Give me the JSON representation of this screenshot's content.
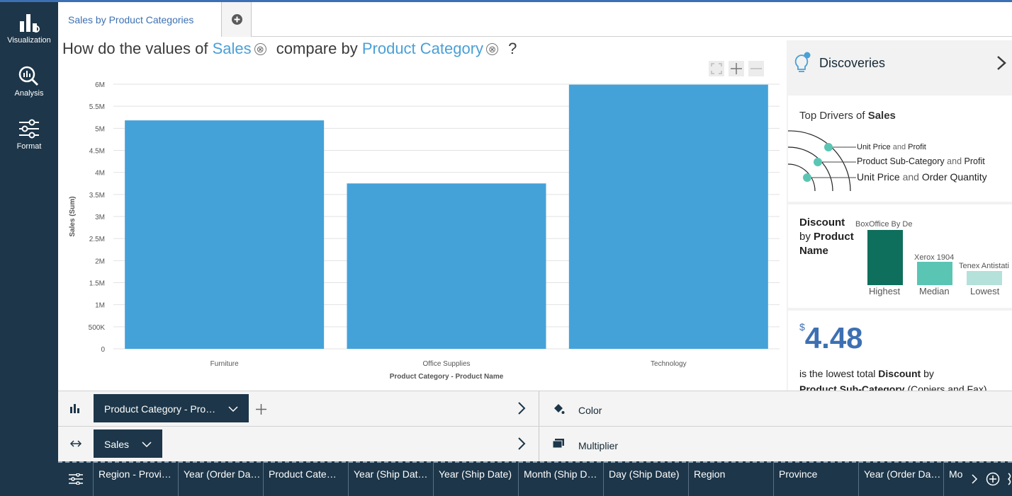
{
  "rail": {
    "items": [
      {
        "label": "Visualization"
      },
      {
        "label": "Analysis"
      },
      {
        "label": "Format"
      }
    ]
  },
  "tabs": [
    {
      "label": "Sales by Product Categories"
    }
  ],
  "question": {
    "p1": "How do the values of",
    "kw1": "Sales",
    "p2": "compare by",
    "kw2": "Product Category",
    "p3": "?",
    "remove_glyph": "⊗"
  },
  "chart_data": {
    "type": "bar",
    "categories": [
      "Furniture",
      "Office Supplies",
      "Technology"
    ],
    "values": [
      5180000,
      3750000,
      5990000
    ],
    "xlabel": "Product Category - Product Name",
    "ylabel": "Sales (Sum)",
    "ylim": [
      0,
      6000000
    ],
    "ytick_labels": [
      "0",
      "500K",
      "1M",
      "1.5M",
      "2M",
      "2.5M",
      "3M",
      "3.5M",
      "4M",
      "4.5M",
      "5M",
      "5.5M",
      "6M"
    ],
    "color": "#45a2d9",
    "grid": true
  },
  "discoveries": {
    "title": "Discoveries",
    "drivers": {
      "title_prefix": "Top Drivers of",
      "title_bold": "Sales",
      "items": [
        {
          "a": "Unit Price",
          "and": "and",
          "b": "Profit"
        },
        {
          "a": "Product Sub-Category",
          "and": "and",
          "b": "Profit"
        },
        {
          "a": "Unit Price",
          "and": "and",
          "b": "Order Quantity"
        }
      ],
      "dot_color": "#5bc5b4"
    },
    "discount": {
      "title_line1": "Discount",
      "title_by": "by",
      "title_line2": "Product",
      "title_line3": "Name",
      "bars": [
        {
          "name": "BoxOffice By De",
          "caption": "Highest",
          "level": 1.0,
          "color": "#0e6f5c"
        },
        {
          "name": "Xerox 1904",
          "caption": "Median",
          "level": 0.42,
          "color": "#5bc5b4"
        },
        {
          "name": "Tenex Antistati",
          "caption": "Lowest",
          "level": 0.26,
          "color": "#b4e1da"
        }
      ]
    },
    "stat": {
      "currency": "$",
      "value": "4.48",
      "text_prefix": "is the lowest total",
      "text_bold1": "Discount",
      "text_by": "by",
      "text_bold2": "Product Sub-Category",
      "text_suffix": "(Copiers and Fax)"
    }
  },
  "shelves": {
    "x": {
      "pill": "Product Category - Pro…"
    },
    "y": {
      "pill": "Sales"
    },
    "color_label": "Color",
    "multiplier_label": "Multiplier"
  },
  "bottom_columns": [
    "Region - Provi…",
    "Year (Order Da…",
    "Product Cate…",
    "Year (Ship Dat…",
    "Year (Ship Date)",
    "Month (Ship D…",
    "Day (Ship Date)",
    "Region",
    "Province",
    "Year (Order Da…",
    "Mo"
  ],
  "colors": {
    "accent": "#4aa0d6",
    "rail": "#1d3649",
    "bar": "#45a2d9"
  }
}
